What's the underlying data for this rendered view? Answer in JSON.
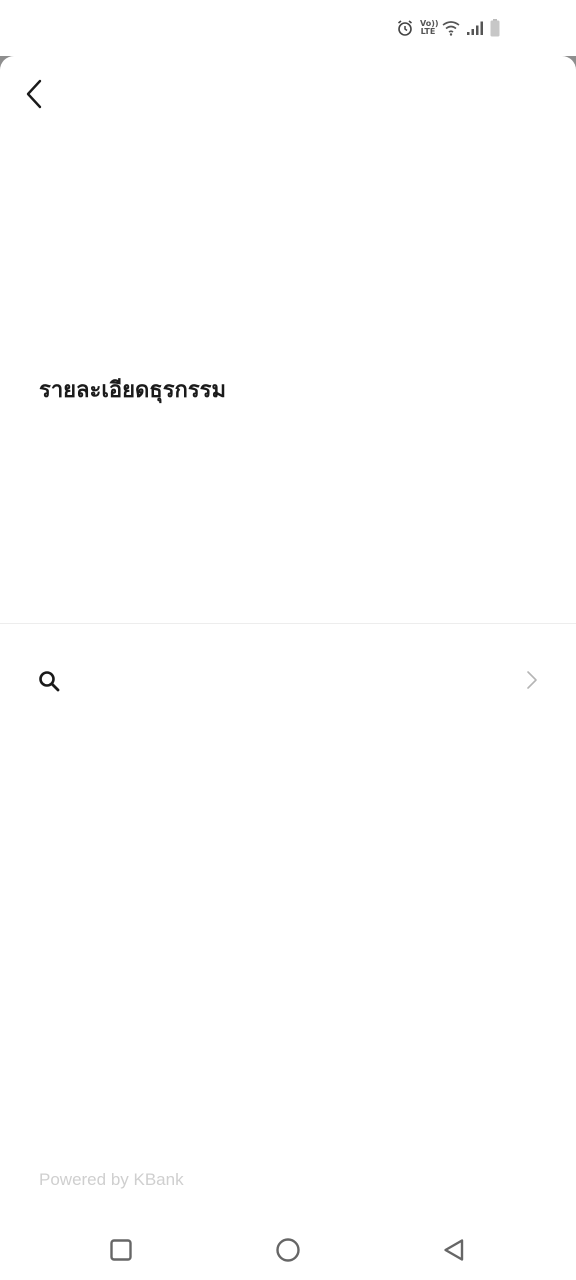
{
  "status_bar": {
    "icons": [
      "alarm-icon",
      "volte-icon",
      "wifi-icon",
      "signal-icon",
      "battery-icon"
    ],
    "volte_top": "Vo))",
    "volte_bottom": "LTE"
  },
  "header": {
    "back_icon": "chevron-left-icon"
  },
  "main": {
    "title": "รายละเอียดธุรกรรม"
  },
  "search_row": {
    "icon": "search-icon",
    "chevron_icon": "chevron-right-icon"
  },
  "footer": {
    "powered_by": "Powered by KBank"
  },
  "nav_bar": {
    "items": [
      "recents-square-icon",
      "home-circle-icon",
      "back-triangle-icon"
    ]
  },
  "colors": {
    "title": "#1a1a1a",
    "powered_by": "#cfcfcf",
    "divider": "#ededed",
    "chevron": "#b5b5b5"
  }
}
